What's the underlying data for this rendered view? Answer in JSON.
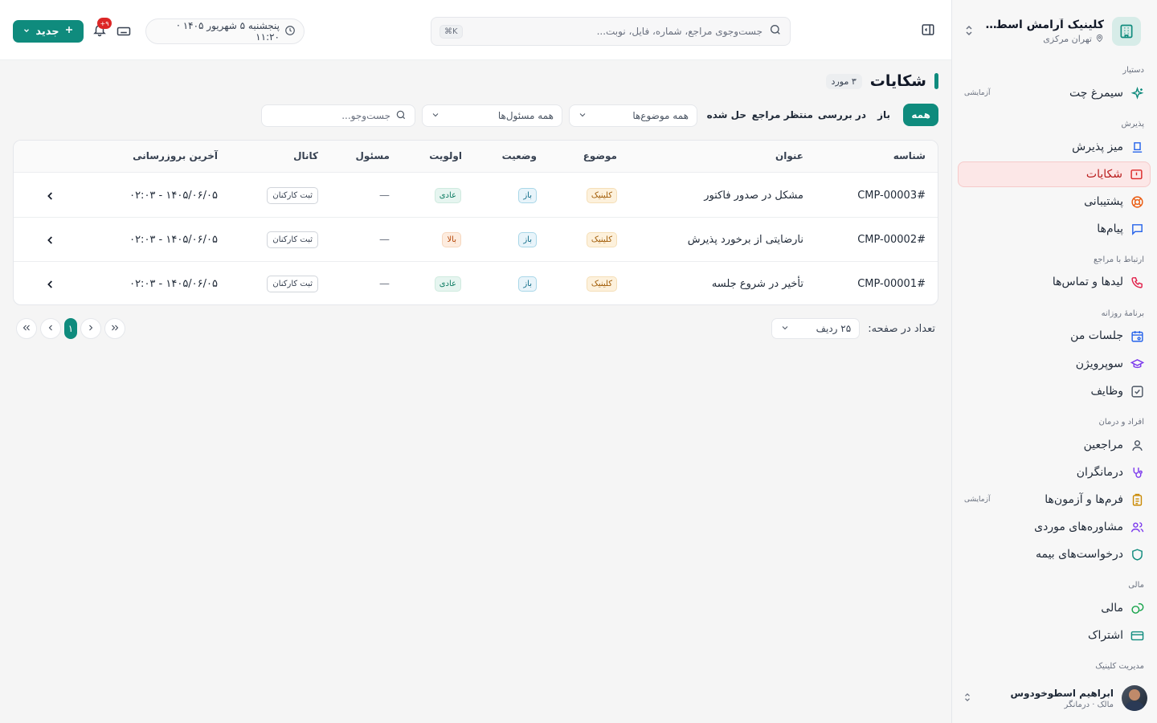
{
  "colors": {
    "accent": "#0f8b7d",
    "danger": "#dc2626",
    "active_nav_bg": "#fce7e7"
  },
  "sidebar": {
    "clinic_name": "کلینیک آرامش اسطوخو...",
    "clinic_location": "تهران مرکزی",
    "groups": [
      {
        "label": "دستیار"
      },
      {
        "label": "پذیرش"
      },
      {
        "label": "ارتباط با مراجع"
      },
      {
        "label": "برنامهٔ روزانه"
      },
      {
        "label": "افراد و درمان"
      },
      {
        "label": "مالی"
      },
      {
        "label": "مدیریت کلینیک"
      }
    ],
    "items": [
      {
        "label": "سیمرغ چت",
        "icon": "sparkle-icon",
        "badge": "آزمایشی"
      },
      {
        "label": "میز پذیرش",
        "icon": "desk-icon"
      },
      {
        "label": "شکایات",
        "icon": "alert-square-icon",
        "active": true
      },
      {
        "label": "پشتیبانی",
        "icon": "lifebuoy-icon"
      },
      {
        "label": "پیام‌ها",
        "icon": "message-icon"
      },
      {
        "label": "لیدها و تماس‌ها",
        "icon": "phone-icon"
      },
      {
        "label": "جلسات من",
        "icon": "calendar-icon"
      },
      {
        "label": "سوپرویژن",
        "icon": "graduation-cap-icon"
      },
      {
        "label": "وظایف",
        "icon": "check-square-icon"
      },
      {
        "label": "مراجعین",
        "icon": "user-icon"
      },
      {
        "label": "درمانگران",
        "icon": "stethoscope-icon"
      },
      {
        "label": "فرم‌ها و آزمون‌ها",
        "icon": "clipboard-icon",
        "badge": "آزمایشی"
      },
      {
        "label": "مشاوره‌های موردی",
        "icon": "users-icon"
      },
      {
        "label": "درخواست‌های بیمه",
        "icon": "shield-icon"
      },
      {
        "label": "مالی",
        "icon": "coins-icon"
      },
      {
        "label": "اشتراک",
        "icon": "credit-card-icon"
      }
    ],
    "user": {
      "name": "ابراهیم اسطوخودوس",
      "role": "مالک · درمانگر"
    }
  },
  "topbar": {
    "search_placeholder": "جست‌وجوی مراجع، شماره، فایل، نوبت...",
    "search_shortcut": "⌘K",
    "date_text": "پنجشنبه ۵ شهریور ۱۴۰۵ · ۱۱:۲۰",
    "notification_count": "۹+",
    "new_button": "جدید"
  },
  "page": {
    "title": "شکایات",
    "count": "۳ مورد",
    "tabs": [
      {
        "label": "همه",
        "active": true
      },
      {
        "label": "باز"
      },
      {
        "label": "در بررسی"
      },
      {
        "label": "منتظر مراجع"
      },
      {
        "label": "حل شده"
      }
    ],
    "subject_filter": "همه موضوع‌ها",
    "owner_filter": "همه مسئول‌ها",
    "search_placeholder": "جست‌وجو..."
  },
  "table": {
    "columns": [
      "شناسه",
      "عنوان",
      "موضوع",
      "وضعیت",
      "اولویت",
      "مسئول",
      "کانال",
      "آخرین بروزرسانی"
    ],
    "rows": [
      {
        "id": "CMP-00003#",
        "title": "مشکل در صدور فاکتور",
        "subject": "کلینیک",
        "status": "باز",
        "priority": "عادی",
        "priority_level": "normal",
        "owner": "—",
        "channel": "ثبت کارکنان",
        "updated": "۱۴۰۵/۰۶/۰۵ - ۰۲:۰۳"
      },
      {
        "id": "CMP-00002#",
        "title": "نارضایتی از برخورد پذیرش",
        "subject": "کلینیک",
        "status": "باز",
        "priority": "بالا",
        "priority_level": "high",
        "owner": "—",
        "channel": "ثبت کارکنان",
        "updated": "۱۴۰۵/۰۶/۰۵ - ۰۲:۰۳"
      },
      {
        "id": "CMP-00001#",
        "title": "تأخیر در شروع جلسه",
        "subject": "کلینیک",
        "status": "باز",
        "priority": "عادی",
        "priority_level": "normal",
        "owner": "—",
        "channel": "ثبت کارکنان",
        "updated": "۱۴۰۵/۰۶/۰۵ - ۰۲:۰۳"
      }
    ]
  },
  "pagination": {
    "page_size_label": "تعداد در صفحه:",
    "page_size": "۲۵ ردیف",
    "current_page": "۱"
  }
}
